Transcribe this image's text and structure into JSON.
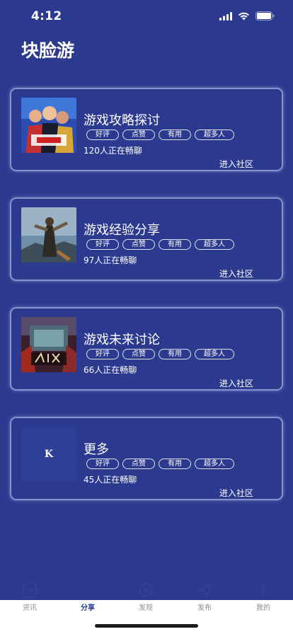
{
  "status_bar": {
    "time": "4:12"
  },
  "header": {
    "title": "块脸游"
  },
  "cards": [
    {
      "title": "游戏攻略探讨",
      "tags": [
        "好评",
        "点赞",
        "有用",
        "超多人"
      ],
      "online": "120人正在畅聊",
      "enter": "进入社区",
      "thumb": "kof-poster"
    },
    {
      "title": "游戏经验分享",
      "tags": [
        "好评",
        "点赞",
        "有用",
        "超多人"
      ],
      "online": "97人正在畅聊",
      "enter": "进入社区",
      "thumb": "warrior-poster"
    },
    {
      "title": "游戏未来讨论",
      "tags": [
        "好评",
        "点赞",
        "有用",
        "超多人"
      ],
      "online": "66人正在畅聊",
      "enter": "进入社区",
      "thumb": "wenjian-poster"
    },
    {
      "title": "更多",
      "tags": [
        "好评",
        "点赞",
        "有用",
        "超多人"
      ],
      "online": "45人正在畅聊",
      "enter": "进入社区",
      "thumb": "k-logo",
      "logo_text": "K"
    }
  ],
  "tabbar": {
    "tabs": [
      {
        "label": "资讯",
        "icon": "news-icon"
      },
      {
        "label": "分享",
        "icon": "share-icon",
        "active": true
      },
      {
        "label": "发现",
        "icon": "discover-icon"
      },
      {
        "label": "发布",
        "icon": "publish-icon"
      },
      {
        "label": "我的",
        "icon": "profile-icon"
      }
    ]
  },
  "colors": {
    "background": "#2b3a8f",
    "active_tab": "#2b3a8f",
    "inactive_tab": "#8d8d8d"
  }
}
